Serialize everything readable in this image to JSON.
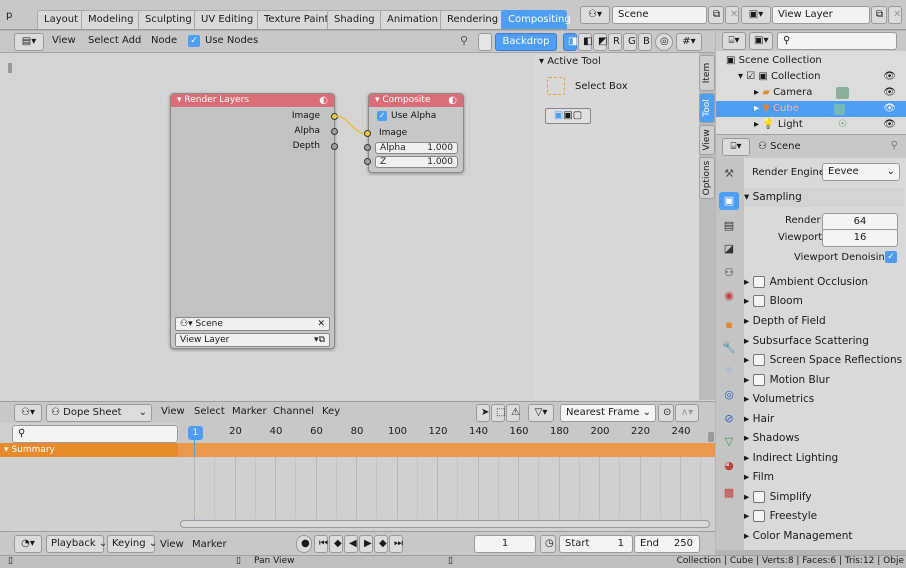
{
  "topbar": {
    "tabs": [
      "Layout",
      "Modeling",
      "Sculpting",
      "UV Editing",
      "Texture Paint",
      "Shading",
      "Animation",
      "Rendering",
      "Compositing"
    ],
    "active_tab": "Compositing",
    "scene": "Scene",
    "view_layer": "View Layer"
  },
  "node_editor": {
    "menu": [
      "View",
      "Select",
      "Add",
      "Node"
    ],
    "use_nodes_label": "Use Nodes",
    "backdrop_label": "Backdrop",
    "channels": [
      "R",
      "G",
      "B"
    ],
    "render_layers": {
      "title": "Render Layers",
      "outputs": [
        "Image",
        "Alpha",
        "Depth"
      ],
      "scene": "Scene",
      "view_layer": "View Layer"
    },
    "composite": {
      "title": "Composite",
      "use_alpha": "Use Alpha",
      "image": "Image",
      "alpha_label": "Alpha",
      "alpha_value": "1.000",
      "z_label": "Z",
      "z_value": "1.000"
    }
  },
  "side_panel": {
    "title": "Active Tool",
    "tool": "Select Box",
    "tabs": [
      "Item",
      "Tool",
      "View",
      "Options"
    ],
    "active_tab": "Tool"
  },
  "outliner": {
    "root": "Scene Collection",
    "items": [
      {
        "name": "Collection"
      },
      {
        "name": "Camera"
      },
      {
        "name": "Cube"
      },
      {
        "name": "Light"
      }
    ]
  },
  "properties": {
    "scene_label": "Scene",
    "render_engine_label": "Render Engine",
    "render_engine": "Eevee",
    "sampling": {
      "title": "Sampling",
      "render_label": "Render",
      "render_value": "64",
      "viewport_label": "Viewport",
      "viewport_value": "16",
      "denoise_label": "Viewport Denoising"
    },
    "sections": [
      "Ambient Occlusion",
      "Bloom",
      "Depth of Field",
      "Subsurface Scattering",
      "Screen Space Reflections",
      "Motion Blur",
      "Volumetrics",
      "Hair",
      "Shadows",
      "Indirect Lighting",
      "Film",
      "Simplify",
      "Freestyle",
      "Color Management"
    ]
  },
  "dopesheet": {
    "mode": "Dope Sheet",
    "menu": [
      "View",
      "Select",
      "Marker",
      "Channel",
      "Key"
    ],
    "interpolation": "Nearest Frame",
    "summary": "Summary",
    "ticks": [
      "20",
      "40",
      "60",
      "80",
      "100",
      "120",
      "140",
      "160",
      "180",
      "200",
      "220",
      "240"
    ],
    "current_frame_badge": "1"
  },
  "timeline": {
    "playback": "Playback",
    "keying": "Keying",
    "view": "View",
    "marker": "Marker",
    "frame": "1",
    "start_label": "Start",
    "start": "1",
    "end_label": "End",
    "end": "250"
  },
  "statusbar": {
    "hint": "Pan View",
    "stats": "Collection | Cube | Verts:8 | Faces:6 | Tris:12 | Obje"
  },
  "colors": {
    "accent": "#4e9ef5",
    "node_header_red": "#d96e78",
    "summary_orange": "#e8892a"
  }
}
